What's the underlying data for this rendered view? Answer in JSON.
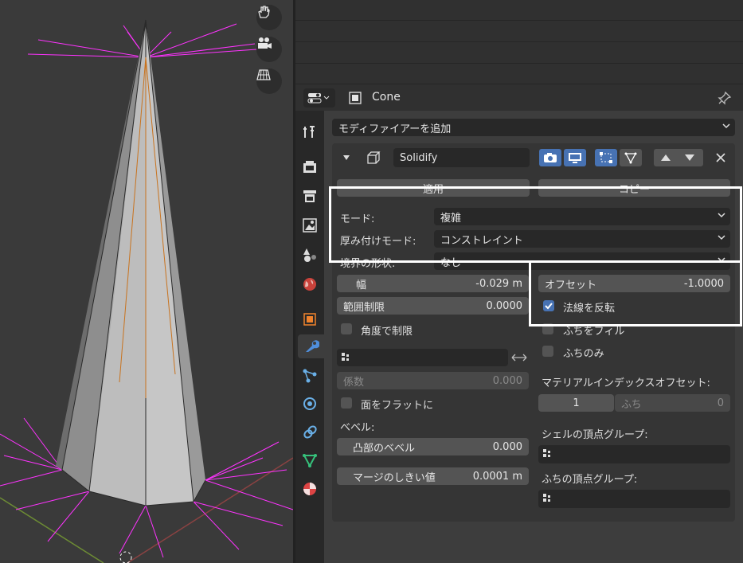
{
  "object": {
    "name": "Cone"
  },
  "modifier": {
    "add_label": "モディファイアーを追加",
    "name": "Solidify",
    "apply_label": "適用",
    "copy_label": "コピー",
    "mode_label": "モード:",
    "mode_value": "複雑",
    "thickness_mode_label": "厚み付けモード:",
    "thickness_mode_value": "コンストレイント",
    "boundary_label": "境界の形状:",
    "boundary_value": "なし",
    "width_label": "幅",
    "width_value": "-0.029 m",
    "offset_label": "オフセット",
    "offset_value": "-1.0000",
    "clamp_label": "範囲制限",
    "clamp_value": "0.0000",
    "flip_label": "法線を反転",
    "flip_checked": true,
    "angle_clamp_label": "角度で制限",
    "fill_rim_label": "ふちをフィル",
    "rim_only_label": "ふちのみ",
    "factor_label": "係数",
    "factor_value": "0.000",
    "flat_faces_label": "面をフラットに",
    "material_offset_label": "マテリアルインデックスオフセット:",
    "material_values": [
      "1",
      "ふち",
      "0"
    ],
    "bevel_label": "ベベル:",
    "convex_label": "凸部のベベル",
    "convex_value": "0.000",
    "merge_label": "マージのしきい値",
    "merge_value": "0.0001 m",
    "shell_vg_label": "シェルの頂点グループ:",
    "rim_vg_label": "ふちの頂点グループ:"
  },
  "colors": {
    "accent": "#4772b3",
    "highlight": "#ffffff",
    "normals": "#ff33ff"
  }
}
